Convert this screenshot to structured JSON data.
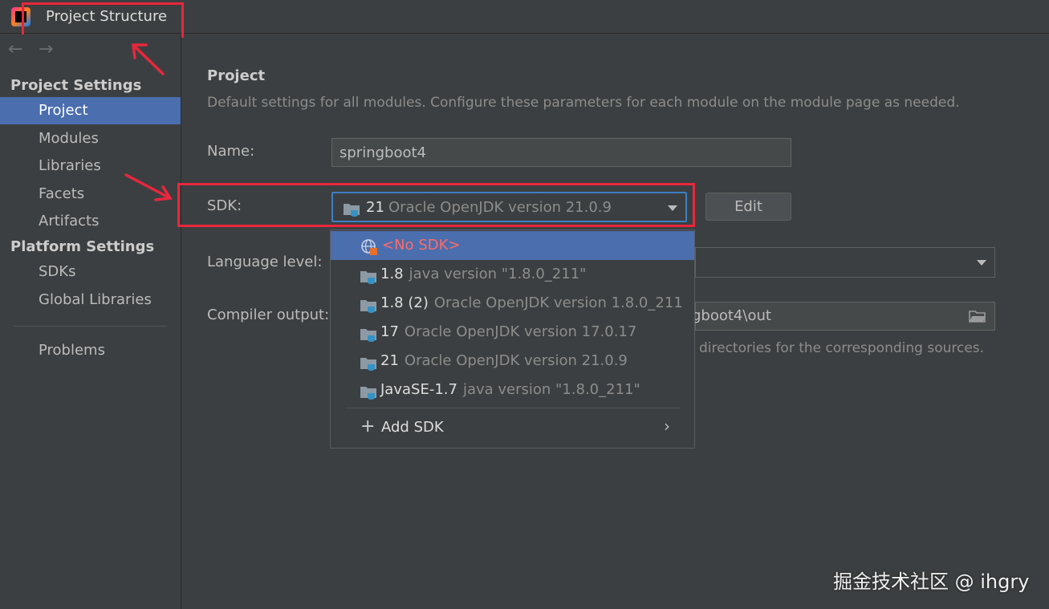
{
  "window": {
    "title": "Project Structure"
  },
  "nav": {
    "back": "←",
    "forward": "→"
  },
  "sidebar": {
    "project_settings_header": "Project Settings",
    "project_settings_items": [
      "Project",
      "Modules",
      "Libraries",
      "Facets",
      "Artifacts"
    ],
    "platform_settings_header": "Platform Settings",
    "platform_settings_items": [
      "SDKs",
      "Global Libraries"
    ],
    "problems": "Problems",
    "selected": "Project"
  },
  "main": {
    "title": "Project",
    "description": "Default settings for all modules. Configure these parameters for each module on the module page as needed.",
    "name_label": "Name:",
    "name_value": "springboot4",
    "sdk_label": "SDK:",
    "sdk_selected_version": "21",
    "sdk_selected_desc": "Oracle OpenJDK version 21.0.9",
    "edit_button": "Edit",
    "language_level_label": "Language level:",
    "compiler_output_label": "Compiler output:",
    "compiler_output_value": "gboot4\\out",
    "hint_text": "directories for the corresponding sources."
  },
  "sdk_popup": {
    "no_sdk": "<No SDK>",
    "items": [
      {
        "version": "1.8",
        "desc": "java version \"1.8.0_211\""
      },
      {
        "version": "1.8 (2)",
        "desc": "Oracle OpenJDK version 1.8.0_211"
      },
      {
        "version": "17",
        "desc": "Oracle OpenJDK version 17.0.17"
      },
      {
        "version": "21",
        "desc": "Oracle OpenJDK version 21.0.9"
      },
      {
        "version": "JavaSE-1.7",
        "desc": "java version \"1.8.0_211\""
      }
    ],
    "add_sdk": "Add SDK"
  },
  "watermark": "掘金技术社区 @ ihgry",
  "colors": {
    "background": "#3c3f41",
    "selection": "#4b6eaf",
    "focus_border": "#3d7fc4",
    "annotation": "#e8273c",
    "no_sdk_text": "#ff6b68",
    "folder_icon": "#8d9aa5",
    "java_badge": "#3592c4"
  },
  "icons": {
    "app": "intellij-logo-icon",
    "folder": "jdk-folder-icon",
    "no_sdk": "globe-no-sdk-icon",
    "browse": "folder-browse-icon",
    "add": "plus-icon",
    "submenu": "chevron-right-icon"
  }
}
